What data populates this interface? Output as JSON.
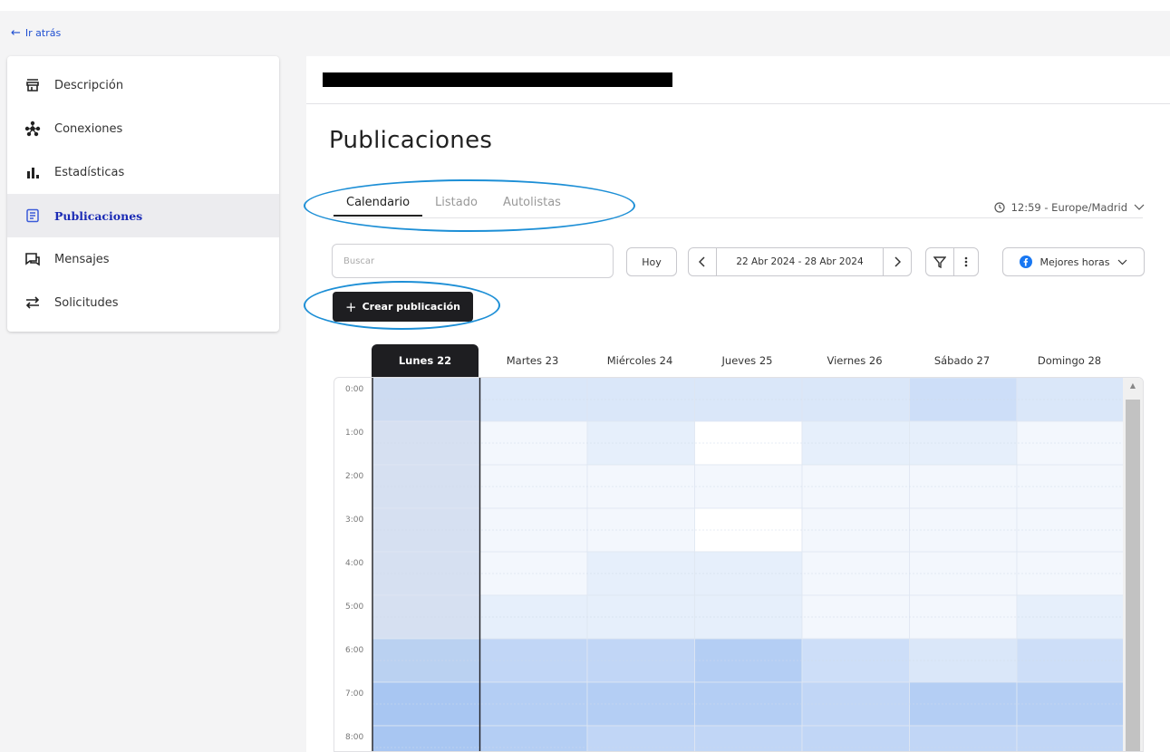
{
  "nav": {
    "back_label": "Ir atrás"
  },
  "sidebar": {
    "items": [
      {
        "label": "Descripción",
        "icon": "store-icon",
        "active": false
      },
      {
        "label": "Conexiones",
        "icon": "network-icon",
        "active": false
      },
      {
        "label": "Estadísticas",
        "icon": "bar-chart-icon",
        "active": false
      },
      {
        "label": "Publicaciones",
        "icon": "document-list-icon",
        "active": true
      },
      {
        "label": "Mensajes",
        "icon": "messages-icon",
        "active": false
      },
      {
        "label": "Solicitudes",
        "icon": "swap-arrows-icon",
        "active": false
      }
    ]
  },
  "main": {
    "title": "Publicaciones",
    "tabs": [
      {
        "label": "Calendario",
        "active": true
      },
      {
        "label": "Listado",
        "active": false
      },
      {
        "label": "Autolistas",
        "active": false
      }
    ],
    "timezone": "12:59 - Europe/Madrid"
  },
  "toolbar": {
    "search_placeholder": "Buscar",
    "today_label": "Hoy",
    "date_range": "22 Abr 2024 - 28 Abr 2024",
    "best_hours_label": "Mejores horas",
    "create_label": "Crear publicación"
  },
  "calendar": {
    "days": [
      "Lunes 22",
      "Martes 23",
      "Miércoles 24",
      "Jueves 25",
      "Viernes 26",
      "Sábado 27",
      "Domingo 28"
    ],
    "active_day_index": 0,
    "hours": [
      "0:00",
      "1:00",
      "2:00",
      "3:00",
      "4:00",
      "5:00",
      "6:00",
      "7:00",
      "8:00"
    ],
    "heat_levels": [
      [
        3,
        3,
        3,
        3,
        3,
        4,
        3
      ],
      [
        2,
        1,
        2,
        0,
        2,
        2,
        1
      ],
      [
        2,
        1,
        1,
        1,
        1,
        1,
        1
      ],
      [
        2,
        1,
        1,
        0,
        1,
        1,
        1
      ],
      [
        2,
        1,
        2,
        2,
        1,
        1,
        1
      ],
      [
        2,
        2,
        2,
        2,
        1,
        1,
        2
      ],
      [
        5,
        5,
        5,
        6,
        4,
        3,
        4
      ],
      [
        7,
        6,
        6,
        6,
        5,
        6,
        6
      ],
      [
        7,
        6,
        5,
        5,
        5,
        5,
        5
      ]
    ]
  },
  "colors": {
    "accent": "#1d8fd6",
    "active_nav": "#1b2bb5",
    "dark": "#1e1e21",
    "heat_base": "#ffffff",
    "heat_max": "#a8c6f2",
    "facebook": "#1877f2"
  }
}
